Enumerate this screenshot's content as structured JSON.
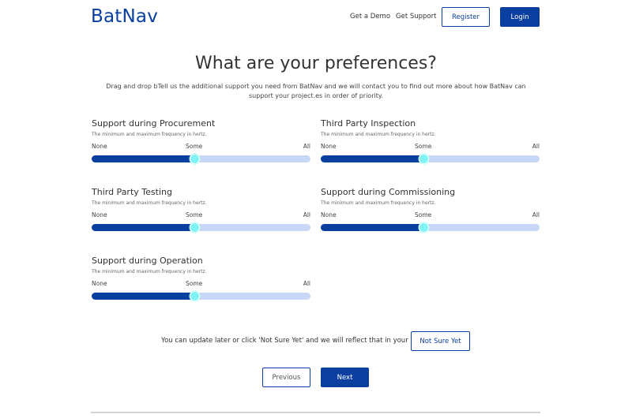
{
  "header": {
    "logo": "BatNav",
    "nav": {
      "demo": "Get a Demo",
      "support": "Get Support"
    },
    "register_label": "Register",
    "login_label": "Login"
  },
  "main": {
    "title": "What are your preferences?",
    "subtitle": "Drag and drop bTell us the additional support you need from BatNav and we will contact you to find out more about how BatNav can support your project.es in order of priority.",
    "tick_labels": {
      "none": "None",
      "some": "Some",
      "all": "All"
    },
    "preferences": [
      {
        "label": "Support during Procurement",
        "description": "The minimum and maximum frequency in hertz.",
        "value": 0.47
      },
      {
        "label": "Third Party Inspection",
        "description": "The minimum and maximum frequency in hertz.",
        "value": 0.47
      },
      {
        "label": "Third Party Testing",
        "description": "The minimum and maximum frequency in hertz.",
        "value": 0.47
      },
      {
        "label": "Support during Commissioning",
        "description": "The minimum and maximum frequency in hertz.",
        "value": 0.47
      },
      {
        "label": "Support during Operation",
        "description": "The minimum and maximum frequency in hertz.",
        "value": 0.47
      }
    ]
  },
  "footer": {
    "update_text": "You can update later or click 'Not Sure Yet' and we will reflect that in your product.",
    "not_sure_label": "Not Sure Yet",
    "previous_label": "Previous",
    "next_label": "Next"
  },
  "colors": {
    "brand": "#0a3fa0",
    "track": "#c9d7f7",
    "thumb": "#7ff3f6"
  }
}
